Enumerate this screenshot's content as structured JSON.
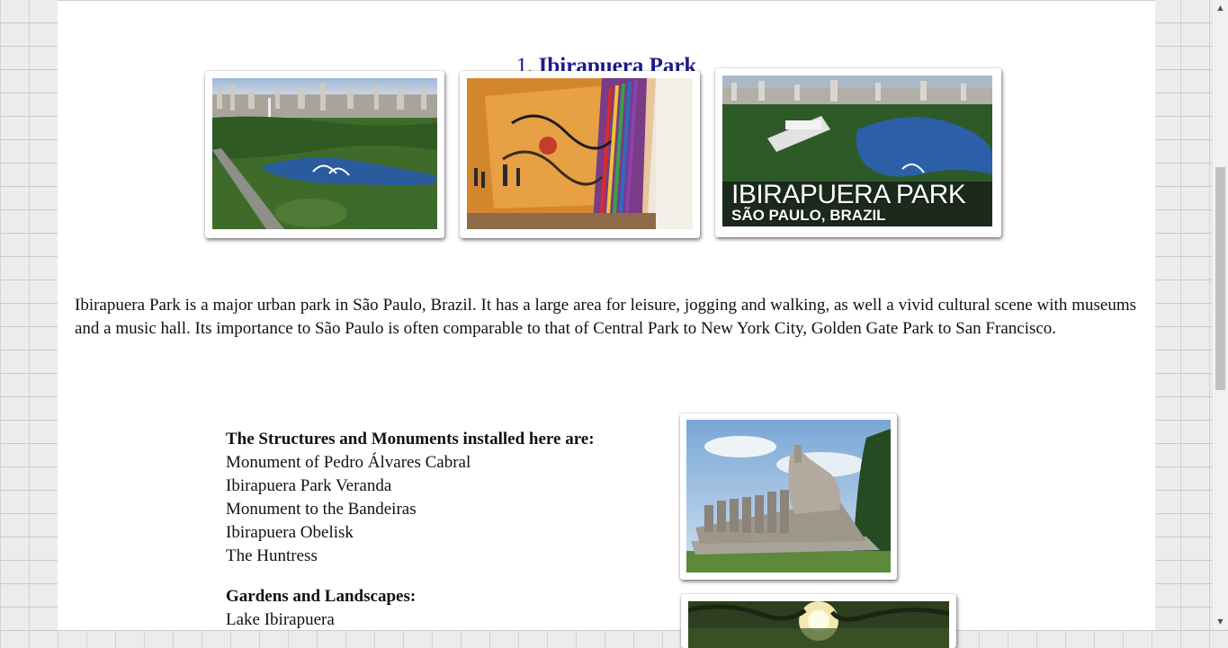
{
  "section": {
    "number": "1.",
    "title": "Ibirapuera Park"
  },
  "gallery": {
    "overlay_title": "IBIRAPUERA PARK",
    "overlay_subtitle": "SÃO PAULO, BRAZIL"
  },
  "description": "Ibirapuera Park is a major urban park in São Paulo, Brazil. It has a large area for leisure, jogging and walking, as well a vivid cultural scene with museums and a music hall. Its importance to São Paulo is often comparable to that of Central Park to New York City, Golden Gate Park to San Francisco.",
  "structures": {
    "heading": "The Structures and Monuments installed here are:",
    "items": [
      "Monument of Pedro Álvares Cabral",
      "Ibirapuera Park Veranda",
      "Monument to the Bandeiras",
      "Ibirapuera Obelisk",
      "The Huntress"
    ]
  },
  "gardens": {
    "heading": "Gardens and Landscapes:",
    "items": [
      "Lake Ibirapuera"
    ]
  },
  "scrollbar": {
    "up_icon": "triangle-up",
    "down_icon": "triangle-down"
  }
}
